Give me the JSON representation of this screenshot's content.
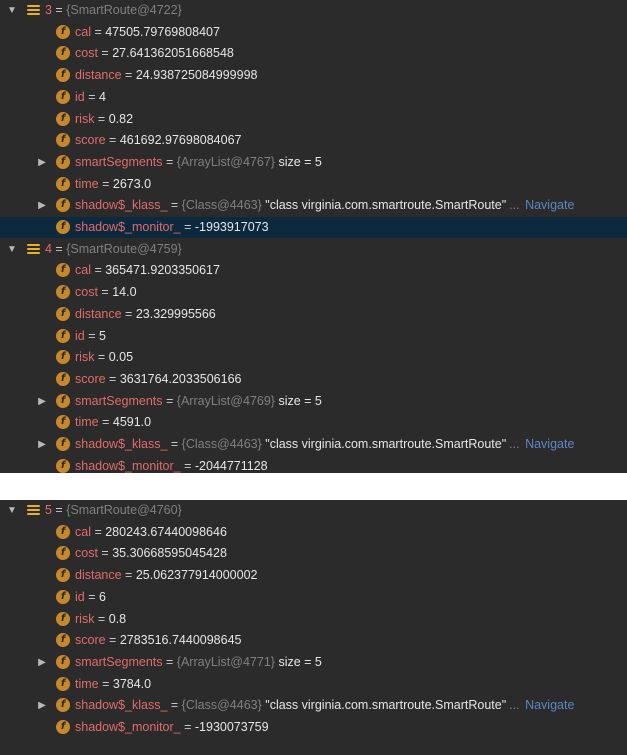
{
  "panels": [
    {
      "groups": [
        {
          "index": "3",
          "ref": "{SmartRoute@4722}",
          "fields": [
            {
              "name": "cal",
              "value": "47505.79769808407"
            },
            {
              "name": "cost",
              "value": "27.641362051668548"
            },
            {
              "name": "distance",
              "value": "24.938725084999998"
            },
            {
              "name": "id",
              "value": "4"
            },
            {
              "name": "risk",
              "value": "0.82"
            },
            {
              "name": "score",
              "value": "461692.97698084067"
            },
            {
              "name": "smartSegments",
              "ref": "{ArrayList@4767}",
              "value": "size = 5",
              "expandable": true
            },
            {
              "name": "time",
              "value": "2673.0"
            },
            {
              "name": "shadow$_klass_",
              "ref": "{Class@4463}",
              "value": "\"class virginia.com.smartroute.SmartRoute\"",
              "dots": "...",
              "link": "Navigate",
              "expandable": true
            },
            {
              "name": "shadow$_monitor_",
              "value": "-1993917073",
              "selected": true
            }
          ]
        },
        {
          "index": "4",
          "ref": "{SmartRoute@4759}",
          "fields": [
            {
              "name": "cal",
              "value": "365471.9203350617"
            },
            {
              "name": "cost",
              "value": "14.0"
            },
            {
              "name": "distance",
              "value": "23.329995566"
            },
            {
              "name": "id",
              "value": "5"
            },
            {
              "name": "risk",
              "value": "0.05"
            },
            {
              "name": "score",
              "value": "3631764.2033506166"
            },
            {
              "name": "smartSegments",
              "ref": "{ArrayList@4769}",
              "value": "size = 5",
              "expandable": true
            },
            {
              "name": "time",
              "value": "4591.0"
            },
            {
              "name": "shadow$_klass_",
              "ref": "{Class@4463}",
              "value": "\"class virginia.com.smartroute.SmartRoute\"",
              "dots": "...",
              "link": "Navigate",
              "expandable": true
            },
            {
              "name": "shadow$_monitor_",
              "value": "-2044771128"
            }
          ]
        }
      ]
    },
    {
      "groups": [
        {
          "index": "5",
          "ref": "{SmartRoute@4760}",
          "fields": [
            {
              "name": "cal",
              "value": "280243.67440098646"
            },
            {
              "name": "cost",
              "value": "35.30668595045428"
            },
            {
              "name": "distance",
              "value": "25.062377914000002"
            },
            {
              "name": "id",
              "value": "6"
            },
            {
              "name": "risk",
              "value": "0.8"
            },
            {
              "name": "score",
              "value": "2783516.7440098645"
            },
            {
              "name": "smartSegments",
              "ref": "{ArrayList@4771}",
              "value": "size = 5",
              "expandable": true
            },
            {
              "name": "time",
              "value": "3784.0"
            },
            {
              "name": "shadow$_klass_",
              "ref": "{Class@4463}",
              "value": "\"class virginia.com.smartroute.SmartRoute\"",
              "dots": "...",
              "link": "Navigate",
              "expandable": true
            },
            {
              "name": "shadow$_monitor_",
              "value": "-1930073759"
            }
          ]
        }
      ]
    }
  ],
  "icons": {
    "expanded": "triangle-down",
    "collapsed": "triangle-right",
    "object": "list-icon",
    "field": "f-circle-icon"
  },
  "colors": {
    "background": "#2b2b2b",
    "field_name": "#e06c6c",
    "ref": "#808080",
    "link": "#5d86c2",
    "selection": "#0d293e",
    "field_icon": "#c7882b"
  }
}
